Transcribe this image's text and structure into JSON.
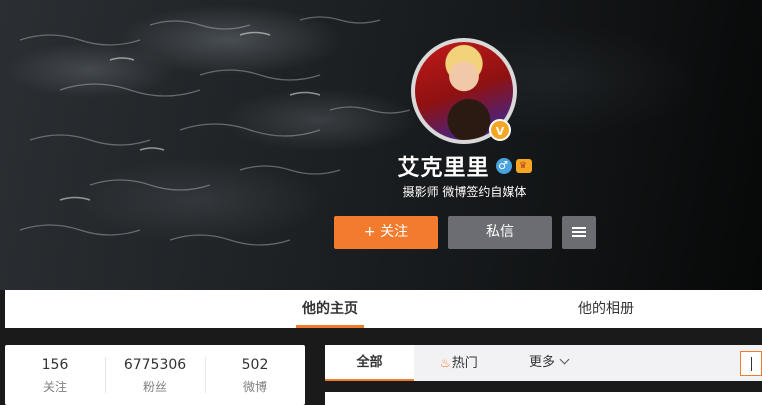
{
  "profile": {
    "name": "艾克里里",
    "description": "摄影师 微博签约自媒体",
    "verified_badge": "V",
    "gender_icon": "male-icon",
    "vip_icon": "vip-crown-icon"
  },
  "actions": {
    "follow_label": "+ 关注",
    "message_label": "私信",
    "more_icon": "menu-icon"
  },
  "tabs": [
    {
      "label": "他的主页",
      "active": true
    },
    {
      "label": "他的相册",
      "active": false
    }
  ],
  "stats": [
    {
      "value": "156",
      "label": "关注"
    },
    {
      "value": "6775306",
      "label": "粉丝"
    },
    {
      "value": "502",
      "label": "微博"
    }
  ],
  "feed_filter": {
    "all_label": "全部",
    "hot_label": "热门",
    "more_label": "更多"
  },
  "colors": {
    "accent": "#f27b2e",
    "button_gray": "#6c6d72",
    "verified": "#f5a623"
  }
}
